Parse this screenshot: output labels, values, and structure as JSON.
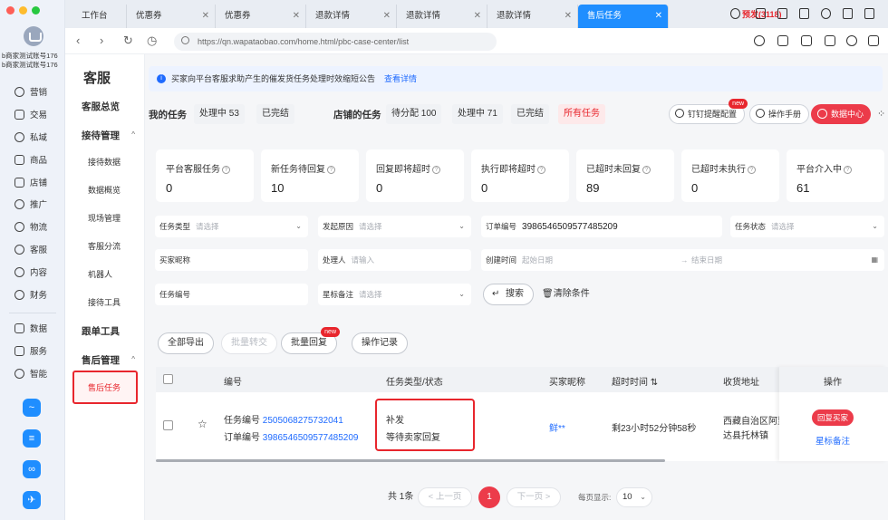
{
  "account": {
    "line1": "b商家测试账号176",
    "line2": "b商家测试账号176"
  },
  "app_nav": [
    {
      "label": "营销",
      "icon": "marketing-icon"
    },
    {
      "label": "交易",
      "icon": "trade-icon"
    },
    {
      "label": "私域",
      "icon": "private-domain-icon"
    },
    {
      "label": "商品",
      "icon": "product-icon"
    },
    {
      "label": "店铺",
      "icon": "store-icon"
    },
    {
      "label": "推广",
      "icon": "promotion-icon"
    },
    {
      "label": "物流",
      "icon": "logistics-icon"
    },
    {
      "label": "客服",
      "icon": "customer-service-icon"
    },
    {
      "label": "内容",
      "icon": "content-icon"
    },
    {
      "label": "财务",
      "icon": "finance-icon"
    },
    {
      "label": "数据",
      "icon": "data-icon"
    },
    {
      "label": "服务",
      "icon": "service-icon"
    },
    {
      "label": "智能",
      "icon": "smart-icon"
    }
  ],
  "tabs": [
    {
      "label": "工作台"
    },
    {
      "label": "优惠券"
    },
    {
      "label": "优惠券"
    },
    {
      "label": "退款详情"
    },
    {
      "label": "退款详情"
    },
    {
      "label": "退款详情"
    },
    {
      "label": "售后任务",
      "active": true
    }
  ],
  "prerelease": "预发(3118)",
  "url": "https://qn.wapataobao.com/home.html/pbc-case-center/list",
  "submenu": {
    "title": "客服",
    "overview": "客服总览",
    "group1": "接待管理",
    "group1_items": [
      "接待数据",
      "数据概览",
      "现场管理",
      "客服分流",
      "机器人",
      "接待工具"
    ],
    "followup": "跟单工具",
    "group2": "售后管理",
    "active_item": "售后任务"
  },
  "notice": {
    "text": "买家向平台客服求助产生的催发货任务处理时效缩短公告",
    "link": "查看详情"
  },
  "filters": {
    "my_tasks": "我的任务",
    "my_processing": "处理中 53",
    "my_done": "已完结",
    "store_tasks": "店铺的任务",
    "store_pending": "待分配 100",
    "store_processing": "处理中 71",
    "store_done": "已完结",
    "all_tasks": "所有任务",
    "dingding": "钉钉提醒配置",
    "dingding_tag": "new",
    "manual": "操作手册",
    "data_center": "数据中心"
  },
  "metrics": [
    {
      "title": "平台客服任务",
      "value": "0"
    },
    {
      "title": "新任务待回复",
      "value": "10"
    },
    {
      "title": "回复即将超时",
      "value": "0"
    },
    {
      "title": "执行即将超时",
      "value": "0"
    },
    {
      "title": "已超时未回复",
      "value": "89"
    },
    {
      "title": "已超时未执行",
      "value": "0"
    },
    {
      "title": "平台介入中",
      "value": "61"
    }
  ],
  "form": {
    "task_type": {
      "label": "任务类型",
      "placeholder": "请选择"
    },
    "reason": {
      "label": "发起原因",
      "placeholder": "请选择"
    },
    "order_no": {
      "label": "订单编号",
      "value": "3986546509577485209"
    },
    "task_status": {
      "label": "任务状态",
      "placeholder": "请选择"
    },
    "buyer_nick": {
      "label": "买家昵称"
    },
    "handler": {
      "label": "处理人",
      "placeholder": "请输入"
    },
    "created": {
      "label": "创建时间",
      "start": "起始日期",
      "end": "结束日期"
    },
    "task_no": {
      "label": "任务编号"
    },
    "star_note": {
      "label": "星标备注",
      "placeholder": "请选择"
    },
    "search": "搜索",
    "clear": "清除条件"
  },
  "actions": {
    "export_all": "全部导出",
    "batch_transfer": "批量转交",
    "batch_reply": "批量回复",
    "batch_reply_tag": "new",
    "op_log": "操作记录"
  },
  "table": {
    "headers": {
      "no": "编号",
      "type_status": "任务类型/状态",
      "buyer": "买家昵称",
      "timeout": "超时时间",
      "address": "收货地址",
      "op": "操作"
    },
    "row": {
      "task_label": "任务编号",
      "task_no": "2505068275732041",
      "order_label": "订单编号",
      "order_no": "3986546509577485209",
      "type": "补发",
      "status": "等待卖家回复",
      "buyer": "鲜**",
      "timeout": "剩23小时52分钟58秒",
      "address_line1": "西藏自治区阿里",
      "address_line2": "达县托林镇",
      "reply_btn": "回复买家",
      "star_btn": "星标备注"
    }
  },
  "pagination": {
    "total": "共 1条",
    "prev": "< 上一页",
    "current": "1",
    "next": "下一页 >",
    "page_size_label": "每页显示:",
    "page_size": "10"
  }
}
